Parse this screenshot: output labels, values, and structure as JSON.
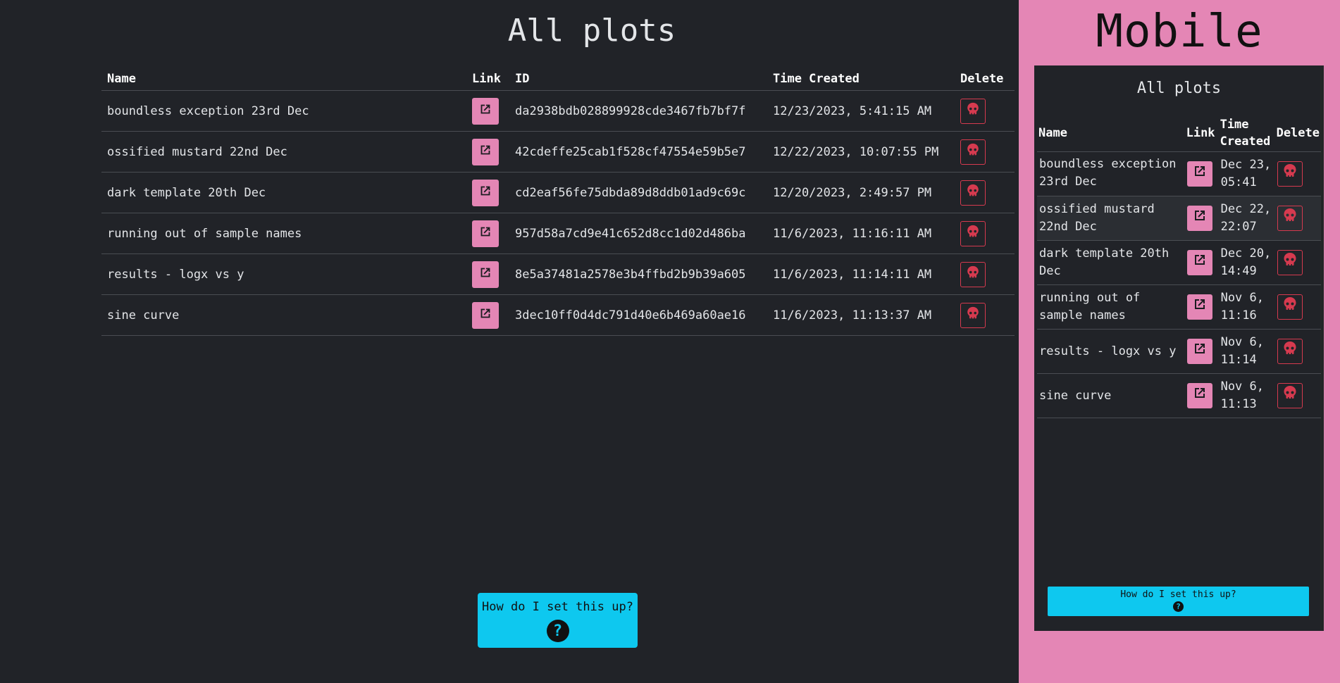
{
  "desktop": {
    "title": "All plots",
    "headers": {
      "name": "Name",
      "link": "Link",
      "id": "ID",
      "time": "Time Created",
      "delete": "Delete"
    },
    "rows": [
      {
        "name": "boundless exception 23rd Dec",
        "id": "da2938bdb028899928cde3467fb7bf7f",
        "time": "12/23/2023, 5:41:15 AM"
      },
      {
        "name": "ossified mustard 22nd Dec",
        "id": "42cdeffe25cab1f528cf47554e59b5e7",
        "time": "12/22/2023, 10:07:55 PM"
      },
      {
        "name": "dark template 20th Dec",
        "id": "cd2eaf56fe75dbda89d8ddb01ad9c69c",
        "time": "12/20/2023, 2:49:57 PM"
      },
      {
        "name": "running out of sample names",
        "id": "957d58a7cd9e41c652d8cc1d02d486ba",
        "time": "11/6/2023, 11:16:11 AM"
      },
      {
        "name": "results - logx vs y",
        "id": "8e5a37481a2578e3b4ffbd2b9b39a605",
        "time": "11/6/2023, 11:14:11 AM"
      },
      {
        "name": "sine curve",
        "id": "3dec10ff0d4dc791d40e6b469a60ae16",
        "time": "11/6/2023, 11:13:37 AM"
      }
    ],
    "help_label": "How do I set this up?",
    "help_icon": "?"
  },
  "mobile": {
    "panel_title": "Mobile",
    "title": "All plots",
    "headers": {
      "name": "Name",
      "link": "Link",
      "time": "Time Created",
      "delete": "Delete"
    },
    "rows": [
      {
        "name": "boundless exception 23rd Dec",
        "time": "Dec 23, 05:41"
      },
      {
        "name": "ossified mustard 22nd Dec",
        "time": "Dec 22, 22:07"
      },
      {
        "name": "dark template 20th Dec",
        "time": "Dec 20, 14:49"
      },
      {
        "name": "running out of sample names",
        "time": "Nov 6, 11:16"
      },
      {
        "name": "results - logx vs y",
        "time": "Nov 6, 11:14"
      },
      {
        "name": "sine curve",
        "time": "Nov 6, 11:13"
      }
    ],
    "help_label": "How do I set this up?",
    "help_icon": "?"
  },
  "colors": {
    "background": "#212328",
    "accent_pink": "#e486b5",
    "danger_red": "#d63a4f",
    "help_cyan": "#0ec8ef"
  },
  "icons": {
    "link": "external-link-icon",
    "delete": "skull-icon",
    "help": "question-circle-icon"
  }
}
